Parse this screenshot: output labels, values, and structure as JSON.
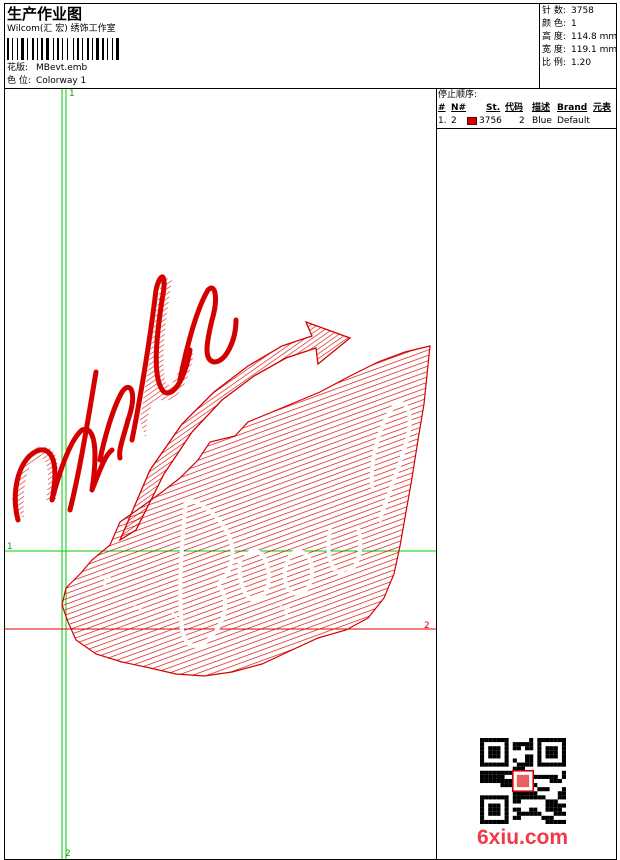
{
  "header": {
    "title": "生产作业图",
    "company": "Wilcom(汇 宏) 绣饰工作室",
    "design_label": "花版:",
    "design_value": "MBevt.emb",
    "colorway_label": "色 位:",
    "colorway_value": "Colorway 1"
  },
  "stats": [
    {
      "label": "针 数:",
      "value": "3758"
    },
    {
      "label": "颜 色:",
      "value": "1"
    },
    {
      "label": "高 度:",
      "value": "114.8 mm"
    },
    {
      "label": "宽 度:",
      "value": "119.1 mm"
    },
    {
      "label": "比 例:",
      "value": "1.20"
    }
  ],
  "stop_sequence": {
    "title": "停止顺序:",
    "columns": [
      "#",
      "N#",
      "St.",
      "代码",
      "描述",
      "Brand",
      "元表"
    ],
    "rows": [
      {
        "index": "1.",
        "needle": "2",
        "color": "#d40000",
        "stitches": "3756",
        "code": "2",
        "description": "Blue",
        "brand": "Default"
      }
    ]
  },
  "guides": {
    "left_top": "1",
    "left_bottom": "2",
    "mid_left": "1",
    "mid_right": "2"
  },
  "watermark": "6xiu.com",
  "colors": {
    "thread": "#d40000",
    "guide_green": "#00cc00",
    "guide_red": "#e00000"
  }
}
